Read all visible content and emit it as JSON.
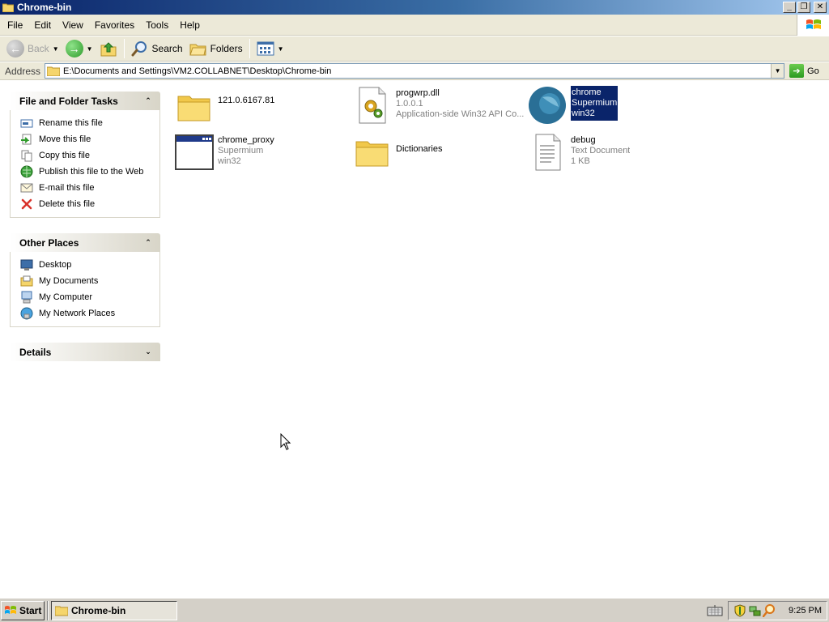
{
  "window": {
    "title": "Chrome-bin"
  },
  "menu": [
    "File",
    "Edit",
    "View",
    "Favorites",
    "Tools",
    "Help"
  ],
  "toolbar": {
    "back": "Back",
    "search": "Search",
    "folders": "Folders"
  },
  "address": {
    "label": "Address",
    "path": "E:\\Documents and Settings\\VM2.COLLABNET\\Desktop\\Chrome-bin",
    "go": "Go"
  },
  "panels": {
    "file_tasks": {
      "title": "File and Folder Tasks",
      "items": [
        "Rename this file",
        "Move this file",
        "Copy this file",
        "Publish this file to the Web",
        "E-mail this file",
        "Delete this file"
      ]
    },
    "other_places": {
      "title": "Other Places",
      "items": [
        "Desktop",
        "My Documents",
        "My Computer",
        "My Network Places"
      ]
    },
    "details": {
      "title": "Details"
    }
  },
  "files": [
    {
      "name": "121.0.6167.81",
      "line2": "",
      "line3": "",
      "icon": "folder-icon"
    },
    {
      "name": "progwrp.dll",
      "line2": "1.0.0.1",
      "line3": "Application-side Win32 API Co...",
      "icon": "dll-icon"
    },
    {
      "name": "chrome",
      "line2": "Supermium",
      "line3": "win32",
      "icon": "supermium-icon",
      "selected": true
    },
    {
      "name": "chrome_proxy",
      "line2": "Supermium",
      "line3": "win32",
      "icon": "app-window-icon"
    },
    {
      "name": "Dictionaries",
      "line2": "",
      "line3": "",
      "icon": "folder-icon"
    },
    {
      "name": "debug",
      "line2": "Text Document",
      "line3": "1 KB",
      "icon": "text-document-icon"
    }
  ],
  "taskbar": {
    "start": "Start",
    "task": "Chrome-bin",
    "clock": "9:25 PM"
  }
}
